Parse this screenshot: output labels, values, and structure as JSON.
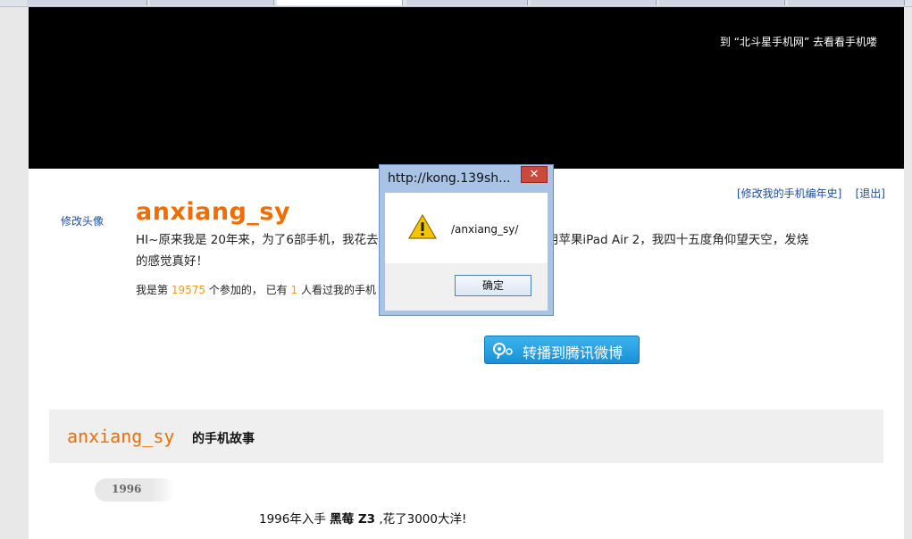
{
  "banner": {
    "link_text": "到 “北斗星手机网” 去看看手机喽"
  },
  "header_links": {
    "edit_history": "[修改我的手机编年史]",
    "logout": "[退出]"
  },
  "profile": {
    "edit_avatar": "修改头像",
    "username": "anxiang_sy",
    "intro": "HI~原来我是 20年来，为了6部手机，我花去了 元，最早是黑莓 Z3，如今爱用苹果iPad Air 2，我四十五度角仰望天空，发烧的感觉真好！",
    "stats_prefix": "我是第",
    "stats_rank": "19575",
    "stats_mid": "个参加的，  已有",
    "stats_views": "1",
    "stats_suffix": "人看过我的手机"
  },
  "weibo_button": {
    "label": "转播到腾讯微博",
    "icon": "tencent-weibo-icon"
  },
  "story": {
    "username": "anxiang_sy",
    "title": "的手机故事"
  },
  "timeline": {
    "year": "1996",
    "entry_prefix": "1996年入手 ",
    "entry_phone": "黑莓 Z3",
    "entry_suffix": " ,花了3000大洋!"
  },
  "dialog": {
    "title": "http://kong.139sh...",
    "close_symbol": "✕",
    "icon": "warning-icon",
    "message": "/anxiang_sy/",
    "ok_label": "确定"
  },
  "colors": {
    "accent_orange": "#f26d00",
    "link_blue": "#1a4d9c",
    "stat_orange": "#f39a1f"
  }
}
